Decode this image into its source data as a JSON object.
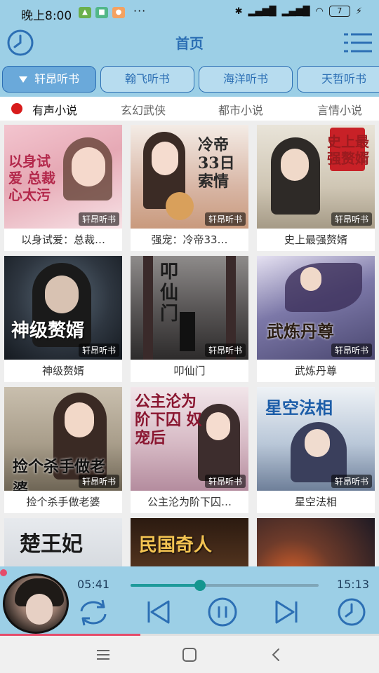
{
  "status_bar": {
    "time": "晚上8:00",
    "more": "···",
    "battery": "7"
  },
  "header": {
    "title": "首页",
    "left_icon": "clock-icon",
    "right_icon": "menu-icon"
  },
  "sources": [
    {
      "label": "轩昂听书",
      "active": true
    },
    {
      "label": "翰飞听书",
      "active": false
    },
    {
      "label": "海洋听书",
      "active": false
    },
    {
      "label": "天哲听书",
      "active": false
    }
  ],
  "categories": [
    {
      "label": "有声小说",
      "active": true
    },
    {
      "label": "玄幻武侠",
      "active": false
    },
    {
      "label": "都市小说",
      "active": false
    },
    {
      "label": "言情小说",
      "active": false
    }
  ],
  "books": [
    {
      "title": "以身试爱：总裁…",
      "cover_text": "以身试爱 总裁心太污",
      "tag": "轩昂听书",
      "color": "#e6a9b5"
    },
    {
      "title": "强宠：冷帝33…",
      "cover_text": "冷帝33日索情",
      "tag": "轩昂听书",
      "color": "#d8b6a5"
    },
    {
      "title": "史上最强赘婿",
      "cover_text": "史上最强赘婿",
      "tag": "轩昂听书",
      "color": "#cfc6b4"
    },
    {
      "title": "神级赘婿",
      "cover_text": "神级赘婿",
      "tag": "轩昂听书",
      "color": "#2e3640"
    },
    {
      "title": "叩仙门",
      "cover_text": "叩仙门",
      "tag": "轩昂听书",
      "color": "#5a5757"
    },
    {
      "title": "武炼丹尊",
      "cover_text": "武炼丹尊",
      "tag": "轩昂听书",
      "color": "#7c78a8"
    },
    {
      "title": "捡个杀手做老婆",
      "cover_text": "捡个杀手做老婆",
      "tag": "轩昂听书",
      "color": "#a89d8a"
    },
    {
      "title": "公主沦为阶下囚…",
      "cover_text": "公主沦为阶下囚 奴宠后",
      "tag": "轩昂听书",
      "color": "#d6b9c4"
    },
    {
      "title": "星空法相",
      "cover_text": "星空法相",
      "tag": "轩昂听书",
      "color": "#b9c7d8"
    },
    {
      "title": "",
      "cover_text": "楚王妃",
      "tag": "",
      "color": "#c4c9cf"
    },
    {
      "title": "",
      "cover_text": "民国奇人",
      "tag": "",
      "color": "#5c3a22"
    },
    {
      "title": "",
      "cover_text": "",
      "tag": "",
      "color": "#6e3b2a"
    }
  ],
  "player": {
    "current_time": "05:41",
    "total_time": "15:13",
    "progress": 0.37,
    "buttons": [
      "loop-icon",
      "previous-icon",
      "pause-icon",
      "next-icon",
      "timer-icon"
    ]
  },
  "colors": {
    "header_bg": "#9ccfe6",
    "accent": "#2c6fb4",
    "active_dot": "#d81b1b"
  }
}
